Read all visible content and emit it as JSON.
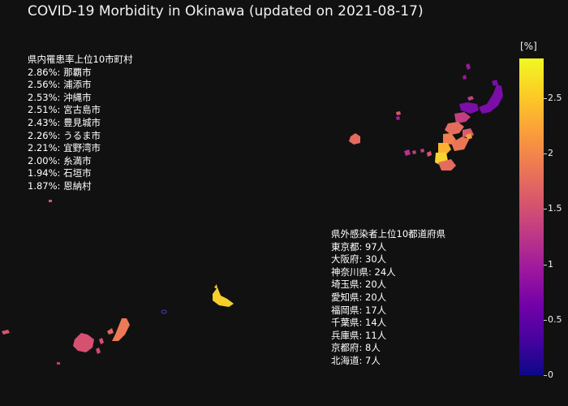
{
  "title": "COVID-19 Morbidity in Okinawa (updated on 2021-08-17)",
  "top_municipalities": {
    "heading": "県内罹患率上位10市町村",
    "items": [
      "2.86%: 那覇市",
      "2.56%: 浦添市",
      "2.53%: 沖縄市",
      "2.51%: 宮古島市",
      "2.43%: 豊見城市",
      "2.26%: うるま市",
      "2.21%: 宜野湾市",
      "2.00%: 糸満市",
      "1.94%: 石垣市",
      "1.87%: 恩納村"
    ]
  },
  "top_prefectures": {
    "heading": "県外感染者上位10都道府県",
    "items": [
      "東京都: 97人",
      "大阪府: 30人",
      "神奈川県: 24人",
      "埼玉県: 20人",
      "愛知県: 20人",
      "福岡県: 17人",
      "千葉県: 14人",
      "兵庫県: 11人",
      "京都府: 8人",
      "北海道: 7人"
    ]
  },
  "colorbar": {
    "title": "[%]",
    "ticks": [
      "0",
      "0.5",
      "1",
      "1.5",
      "2",
      "2.5"
    ],
    "tick_values": [
      0,
      0.5,
      1,
      1.5,
      2,
      2.5
    ],
    "max": 2.86,
    "colorscale": [
      "#0d0887",
      "#46039f",
      "#7201a8",
      "#9c179e",
      "#bd3786",
      "#d8576b",
      "#ed7953",
      "#fb9f3a",
      "#fdca26",
      "#f0f921"
    ]
  },
  "colors": {
    "background": "#111111",
    "text": "#ffffff"
  }
}
